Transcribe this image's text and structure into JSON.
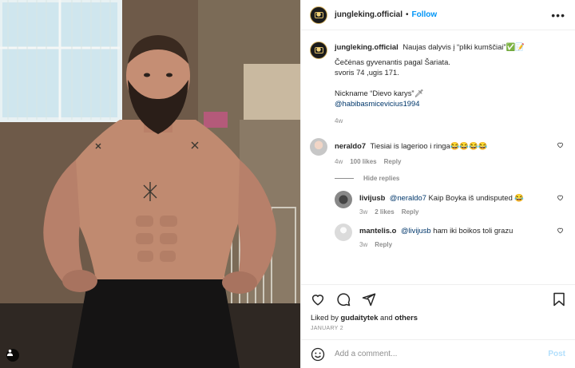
{
  "header": {
    "username": "jungleking.official",
    "separator": "•",
    "follow_label": "Follow",
    "more_label": "•••"
  },
  "caption": {
    "username": "jungleking.official",
    "text": "Naujas dalyvis į “pliki kumščiai”✅📝",
    "line1": "Čečėnas gyvenantis pagal Šariata.",
    "line2": "svoris 74 ,ugis 171.",
    "line3": "Nickname “Dievo karys”🗡",
    "mention": "@habibasmicevicius1994",
    "time": "4w"
  },
  "comments": [
    {
      "username": "neraldo7",
      "text": "Tiesiai is lagerioo i ringa😂😂😂😂",
      "time": "4w",
      "likes": "100 likes",
      "reply_label": "Reply"
    }
  ],
  "hide_replies_label": "Hide replies",
  "replies": [
    {
      "username": "livijusb",
      "mention": "@neraldo7",
      "text": "Kaip Boyka iš undisputed 😂",
      "time": "3w",
      "likes": "2 likes",
      "reply_label": "Reply"
    },
    {
      "username": "mantelis.o",
      "mention": "@livijusb",
      "text": "ham iki boikos toli grazu",
      "time": "3w",
      "reply_label": "Reply"
    }
  ],
  "liked_by": {
    "prefix": "Liked by",
    "user": "gudaitytek",
    "and": "and",
    "others": "others"
  },
  "date": "JANUARY 2",
  "add_comment": {
    "placeholder": "Add a comment...",
    "post_label": "Post"
  },
  "colors": {
    "follow_blue": "#0095f6",
    "mention_blue": "#00376b",
    "post_disabled": "#b2dffc",
    "muted_gray": "#8e8e8e"
  },
  "icons": [
    "heart-icon",
    "comment-icon",
    "share-icon",
    "bookmark-icon",
    "emoji-icon",
    "user-tag-icon",
    "more-icon"
  ]
}
